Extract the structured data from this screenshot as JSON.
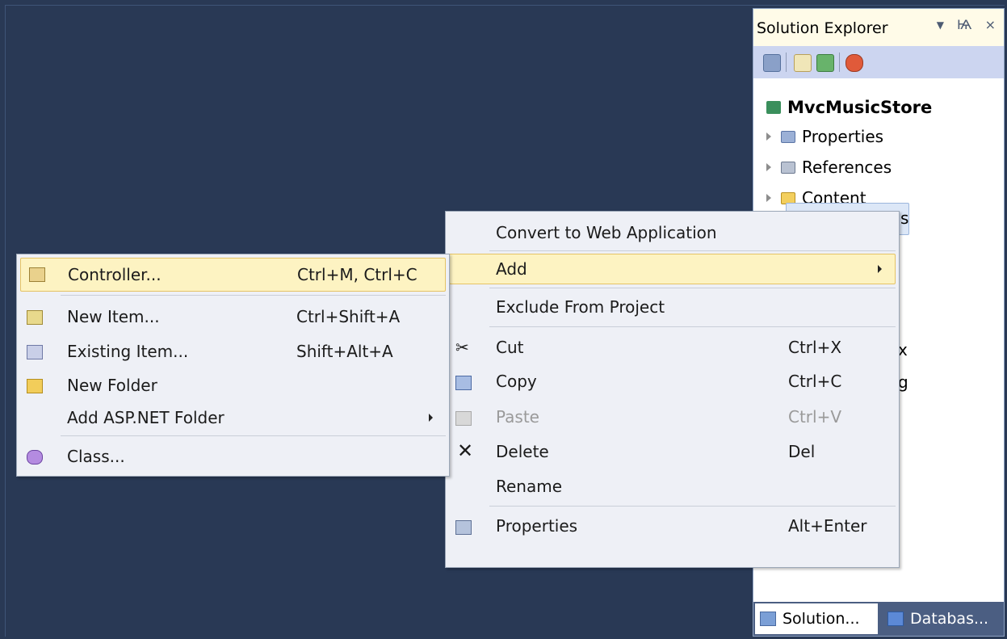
{
  "solution_explorer": {
    "title": "Solution Explorer",
    "pin_glyph": "Ѩ",
    "close_glyph": "×",
    "project": "MvcMusicStore",
    "items": [
      "Properties",
      "References",
      "Content"
    ],
    "partial_text": {
      "controllers_tail": "s",
      "peek1": "x",
      "peek2": "g"
    },
    "tabs": {
      "solution": "Solution...",
      "database": "Databas..."
    }
  },
  "context_menu": {
    "items": [
      {
        "label": "Convert to Web Application",
        "shortcut": ""
      },
      {
        "label": "Add",
        "shortcut": ""
      },
      {
        "label": "Exclude From Project",
        "shortcut": ""
      },
      {
        "label": "Cut",
        "shortcut": "Ctrl+X"
      },
      {
        "label": "Copy",
        "shortcut": "Ctrl+C"
      },
      {
        "label": "Paste",
        "shortcut": "Ctrl+V"
      },
      {
        "label": "Delete",
        "shortcut": "Del"
      },
      {
        "label": "Rename",
        "shortcut": ""
      },
      {
        "label": "Properties",
        "shortcut": "Alt+Enter"
      }
    ]
  },
  "add_submenu": {
    "items": [
      {
        "label": "Controller...",
        "shortcut": "Ctrl+M, Ctrl+C"
      },
      {
        "label": "New Item...",
        "shortcut": "Ctrl+Shift+A"
      },
      {
        "label": "Existing Item...",
        "shortcut": "Shift+Alt+A"
      },
      {
        "label": "New Folder",
        "shortcut": ""
      },
      {
        "label": "Add ASP.NET Folder",
        "shortcut": ""
      },
      {
        "label": "Class...",
        "shortcut": ""
      }
    ]
  },
  "colors": {
    "ide_background": "#293955",
    "menu_background": "#eef0f6",
    "highlight": "#fdf3c2",
    "highlight_border": "#e5c365",
    "selection": "#dce7f7"
  }
}
